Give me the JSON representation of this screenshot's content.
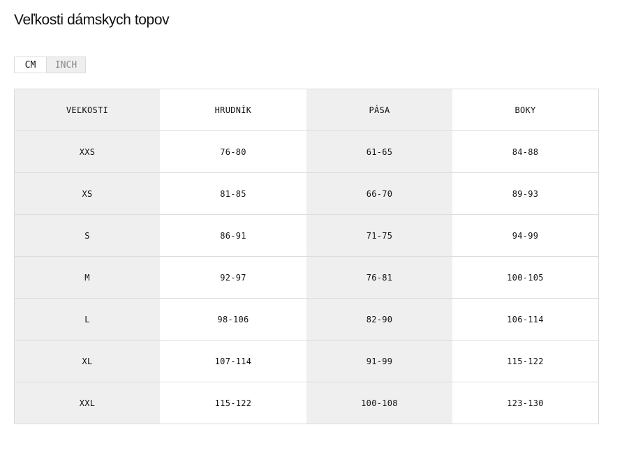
{
  "page": {
    "title": "Veľkosti dámskych topov"
  },
  "unit_toggle": {
    "options": [
      {
        "label": "CM",
        "selected": true
      },
      {
        "label": "INCH",
        "selected": false
      }
    ]
  },
  "size_table": {
    "headers": [
      "VEĽKOSTI",
      "HRUDNÍK",
      "PÁSA",
      "BOKY"
    ],
    "rows": [
      [
        "XXS",
        "76-80",
        "61-65",
        "84-88"
      ],
      [
        "XS",
        "81-85",
        "66-70",
        "89-93"
      ],
      [
        "S",
        "86-91",
        "71-75",
        "94-99"
      ],
      [
        "M",
        "92-97",
        "76-81",
        "100-105"
      ],
      [
        "L",
        "98-106",
        "82-90",
        "106-114"
      ],
      [
        "XL",
        "107-114",
        "91-99",
        "115-122"
      ],
      [
        "XXL",
        "115-122",
        "100-108",
        "123-130"
      ]
    ]
  },
  "colors": {
    "text": "#111111",
    "shaded_column": "#efefef",
    "border": "#dcdcdc",
    "inactive_toggle_text": "#8a8a8a"
  }
}
